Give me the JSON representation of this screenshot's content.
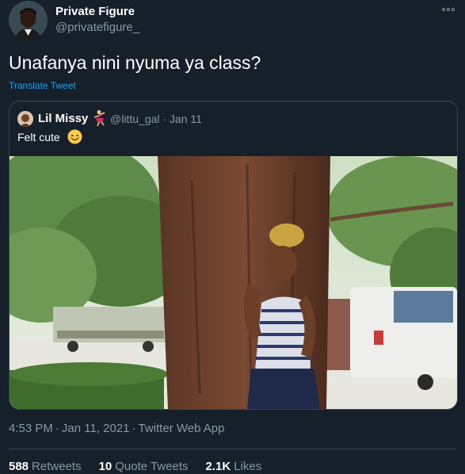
{
  "author": {
    "name": "Private Figure",
    "handle": "@privatefigure_"
  },
  "tweet": {
    "text": "Unafanya nini nyuma ya class?",
    "translate_label": "Translate Tweet"
  },
  "quoted": {
    "name": "Lil Missy",
    "handle_date": "@littu_gal · Jan 11",
    "text": "Felt cute",
    "emoji_after_name": "dancer-emoji",
    "emoji_after_text": "smiling-face-emoji"
  },
  "meta": {
    "time": "4:53 PM",
    "date": "Jan 11, 2021",
    "source": "Twitter Web App",
    "separator": "·"
  },
  "stats": [
    {
      "count": "588",
      "label": "Retweets"
    },
    {
      "count": "10",
      "label": "Quote Tweets"
    },
    {
      "count": "2.1K",
      "label": "Likes"
    }
  ],
  "colors": {
    "background": "#15202b",
    "secondary_text": "#8899a6",
    "link": "#1da1f2",
    "border": "#38444d"
  }
}
